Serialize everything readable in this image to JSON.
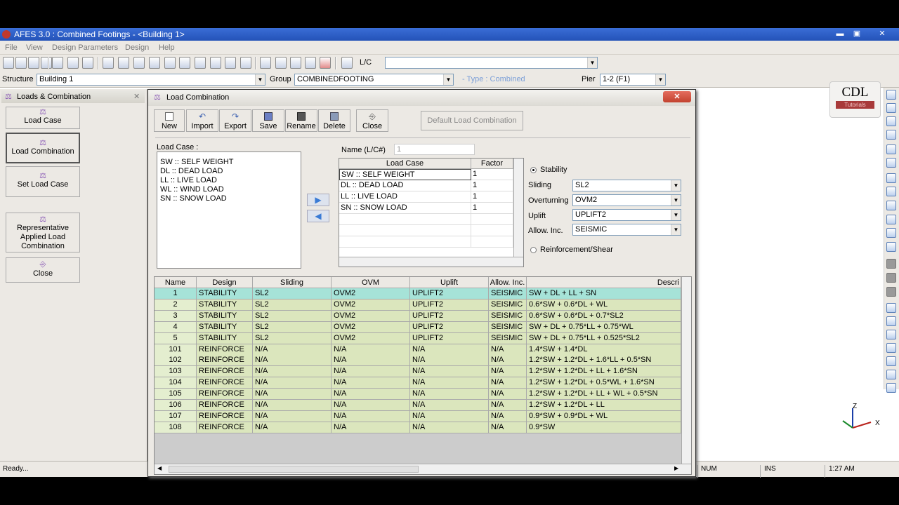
{
  "window": {
    "title": "AFES 3.0 : Combined Footings - <Building 1>",
    "min": "▬",
    "max": "▣",
    "close": "✕"
  },
  "menu": [
    "File",
    "View",
    "Design Parameters",
    "Design",
    "Help"
  ],
  "toolbar": {
    "lc_label": "L/C"
  },
  "selectors": {
    "structure_label": "Structure",
    "structure_value": "Building 1",
    "group_label": "Group",
    "group_value": "COMBINEDFOOTING",
    "type_text": "- Type : Combined",
    "pier_label": "Pier",
    "pier_value": "1-2 (F1)"
  },
  "left_panel": {
    "title": "Loads & Combination",
    "close": "✕",
    "buttons": [
      "Load Case",
      "Load  Combination",
      "Set Load Case",
      "Representative Applied Load Combination",
      "Close"
    ]
  },
  "branding": {
    "logo": "CDL",
    "sub": "Tutorials"
  },
  "axis": {
    "z": "Z",
    "x": "X"
  },
  "dialog": {
    "title": "Load Combination",
    "close": "✕",
    "toolbar": [
      "New",
      "Import",
      "Export",
      "Save",
      "Rename",
      "Delete",
      "Close"
    ],
    "default_button": "Default Load Combination",
    "load_case_label": "Load Case :",
    "load_cases": [
      "SW :: SELF WEIGHT",
      "DL :: DEAD LOAD",
      "LL :: LIVE LOAD",
      "WL :: WIND LOAD",
      "SN :: SNOW LOAD"
    ],
    "arrow_add": "▶",
    "arrow_remove": "◀",
    "name_label": "Name (L/C#)",
    "name_value": "1",
    "lc_grid_headers": [
      "Load Case",
      "Factor"
    ],
    "lc_grid_rows": [
      {
        "case": "SW :: SELF WEIGHT",
        "factor": "1"
      },
      {
        "case": "DL :: DEAD LOAD",
        "factor": "1"
      },
      {
        "case": "LL :: LIVE LOAD",
        "factor": "1"
      },
      {
        "case": "SN :: SNOW LOAD",
        "factor": "1"
      }
    ],
    "stability_label": "Stability",
    "sliding_label": "Sliding",
    "sliding_value": "SL2",
    "overturning_label": "Overturning",
    "overturning_value": "OVM2",
    "uplift_label": "Uplift",
    "uplift_value": "UPLIFT2",
    "allow_label": "Allow. Inc.",
    "allow_value": "SEISMIC",
    "reinforcement_label": "Reinforcement/Shear",
    "grid_headers": [
      "Name",
      "Design",
      "Sliding",
      "OVM",
      "Uplift",
      "Allow. Inc.",
      "Descri"
    ],
    "grid_rows": [
      {
        "name": "1",
        "design": "STABILITY",
        "sliding": "SL2",
        "ovm": "OVM2",
        "uplift": "UPLIFT2",
        "allow": "SEISMIC",
        "desc": "SW + DL + LL + SN"
      },
      {
        "name": "2",
        "design": "STABILITY",
        "sliding": "SL2",
        "ovm": "OVM2",
        "uplift": "UPLIFT2",
        "allow": "SEISMIC",
        "desc": "0.6*SW + 0.6*DL + WL"
      },
      {
        "name": "3",
        "design": "STABILITY",
        "sliding": "SL2",
        "ovm": "OVM2",
        "uplift": "UPLIFT2",
        "allow": "SEISMIC",
        "desc": "0.6*SW + 0.6*DL + 0.7*SL2"
      },
      {
        "name": "4",
        "design": "STABILITY",
        "sliding": "SL2",
        "ovm": "OVM2",
        "uplift": "UPLIFT2",
        "allow": "SEISMIC",
        "desc": "SW + DL + 0.75*LL + 0.75*WL"
      },
      {
        "name": "5",
        "design": "STABILITY",
        "sliding": "SL2",
        "ovm": "OVM2",
        "uplift": "UPLIFT2",
        "allow": "SEISMIC",
        "desc": "SW + DL + 0.75*LL + 0.525*SL2"
      },
      {
        "name": "101",
        "design": "REINFORCE",
        "sliding": "N/A",
        "ovm": "N/A",
        "uplift": "N/A",
        "allow": "N/A",
        "desc": "1.4*SW + 1.4*DL"
      },
      {
        "name": "102",
        "design": "REINFORCE",
        "sliding": "N/A",
        "ovm": "N/A",
        "uplift": "N/A",
        "allow": "N/A",
        "desc": "1.2*SW + 1.2*DL + 1.6*LL + 0.5*SN"
      },
      {
        "name": "103",
        "design": "REINFORCE",
        "sliding": "N/A",
        "ovm": "N/A",
        "uplift": "N/A",
        "allow": "N/A",
        "desc": "1.2*SW + 1.2*DL + LL + 1.6*SN"
      },
      {
        "name": "104",
        "design": "REINFORCE",
        "sliding": "N/A",
        "ovm": "N/A",
        "uplift": "N/A",
        "allow": "N/A",
        "desc": "1.2*SW + 1.2*DL + 0.5*WL + 1.6*SN"
      },
      {
        "name": "105",
        "design": "REINFORCE",
        "sliding": "N/A",
        "ovm": "N/A",
        "uplift": "N/A",
        "allow": "N/A",
        "desc": "1.2*SW + 1.2*DL + LL + WL + 0.5*SN"
      },
      {
        "name": "106",
        "design": "REINFORCE",
        "sliding": "N/A",
        "ovm": "N/A",
        "uplift": "N/A",
        "allow": "N/A",
        "desc": "1.2*SW + 1.2*DL + LL"
      },
      {
        "name": "107",
        "design": "REINFORCE",
        "sliding": "N/A",
        "ovm": "N/A",
        "uplift": "N/A",
        "allow": "N/A",
        "desc": "0.9*SW + 0.9*DL + WL"
      },
      {
        "name": "108",
        "design": "REINFORCE",
        "sliding": "N/A",
        "ovm": "N/A",
        "uplift": "N/A",
        "allow": "N/A",
        "desc": "0.9*SW"
      }
    ]
  },
  "status": {
    "ready": "Ready...",
    "num": "NUM",
    "ins": "INS",
    "time": "1:27 AM"
  }
}
